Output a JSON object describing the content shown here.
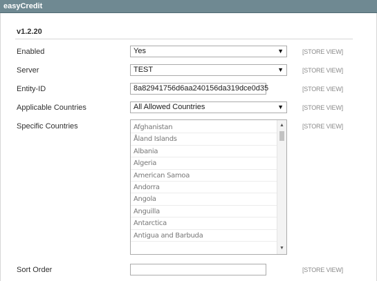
{
  "header": {
    "title": "easyCredit"
  },
  "section": {
    "version": "v1.2.20"
  },
  "fields": {
    "enabled": {
      "label": "Enabled",
      "value": "Yes",
      "scope": "[STORE VIEW]"
    },
    "server": {
      "label": "Server",
      "value": "TEST",
      "scope": "[STORE VIEW]"
    },
    "entity_id": {
      "label": "Entity-ID",
      "value": "8a82941756d6aa240156da319dce0d35",
      "scope": "[STORE VIEW]"
    },
    "applicable_countries": {
      "label": "Applicable Countries",
      "value": "All Allowed Countries",
      "scope": "[STORE VIEW]"
    },
    "specific_countries": {
      "label": "Specific Countries",
      "scope": "[STORE VIEW]",
      "options": [
        "Afghanistan",
        "Åland Islands",
        "Albania",
        "Algeria",
        "American Samoa",
        "Andorra",
        "Angola",
        "Anguilla",
        "Antarctica",
        "Antigua and Barbuda"
      ]
    },
    "sort_order": {
      "label": "Sort Order",
      "value": "",
      "scope": "[STORE VIEW]"
    }
  },
  "icons": {
    "dropdown": "chevron-down-icon",
    "scroll_up": "scroll-up-icon",
    "scroll_down": "scroll-down-icon"
  }
}
